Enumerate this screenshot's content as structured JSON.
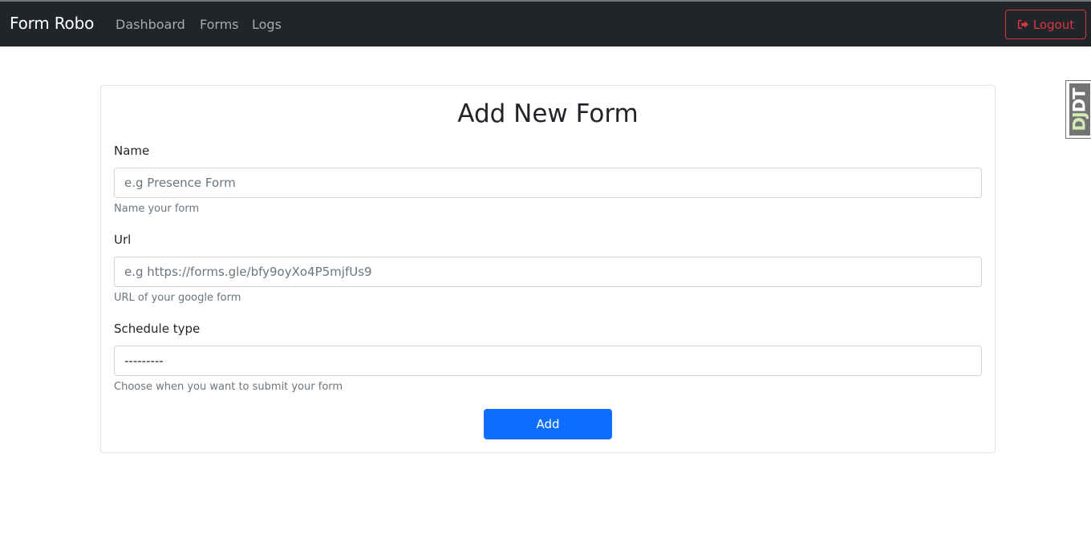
{
  "navbar": {
    "brand": "Form Robo",
    "links": [
      {
        "label": "Dashboard"
      },
      {
        "label": "Forms"
      },
      {
        "label": "Logs"
      }
    ],
    "logout_label": "Logout",
    "logout_icon": "sign-out-icon"
  },
  "debug_toolbar": {
    "prefix": "DJ",
    "suffix": "DT"
  },
  "form": {
    "title": "Add New Form",
    "fields": [
      {
        "label": "Name",
        "placeholder": "e.g Presence Form",
        "value": "",
        "help": "Name your form"
      },
      {
        "label": "Url",
        "placeholder": "e.g https://forms.gle/bfy9oyXo4P5mjfUs9",
        "value": "",
        "help": "URL of your google form"
      },
      {
        "label": "Schedule type",
        "selected": "---------",
        "help": "Choose when you want to submit your form"
      }
    ],
    "submit_label": "Add"
  },
  "colors": {
    "navbar_bg": "#212529",
    "danger": "#dc3545",
    "primary": "#0d6efd",
    "muted": "#6c757d"
  }
}
